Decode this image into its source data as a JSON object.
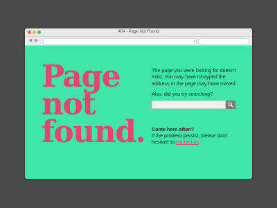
{
  "browser": {
    "window_title": "404 - Page Not Found",
    "back_icon": "back-arrow-icon",
    "forward_icon": "forward-arrow-icon",
    "address_value": "",
    "search_value": ""
  },
  "page": {
    "headline_lines": [
      "Page",
      "not",
      "found."
    ],
    "message": "The page you were looking for doesn't exist. You may have mistyped the address or the page may have moved.",
    "search_prompt": "Also, did you try searching?",
    "search_value": "",
    "search_button_icon": "magnifier-icon",
    "come_heading": "Come here often?",
    "persist_text": "If the problem persist, please don't hesitate to",
    "contact_link": "contact us",
    "persist_end": "."
  },
  "colors": {
    "background": "#4a4a4a",
    "page_bg": "#3ee6a9",
    "accent": "#e8446f"
  }
}
